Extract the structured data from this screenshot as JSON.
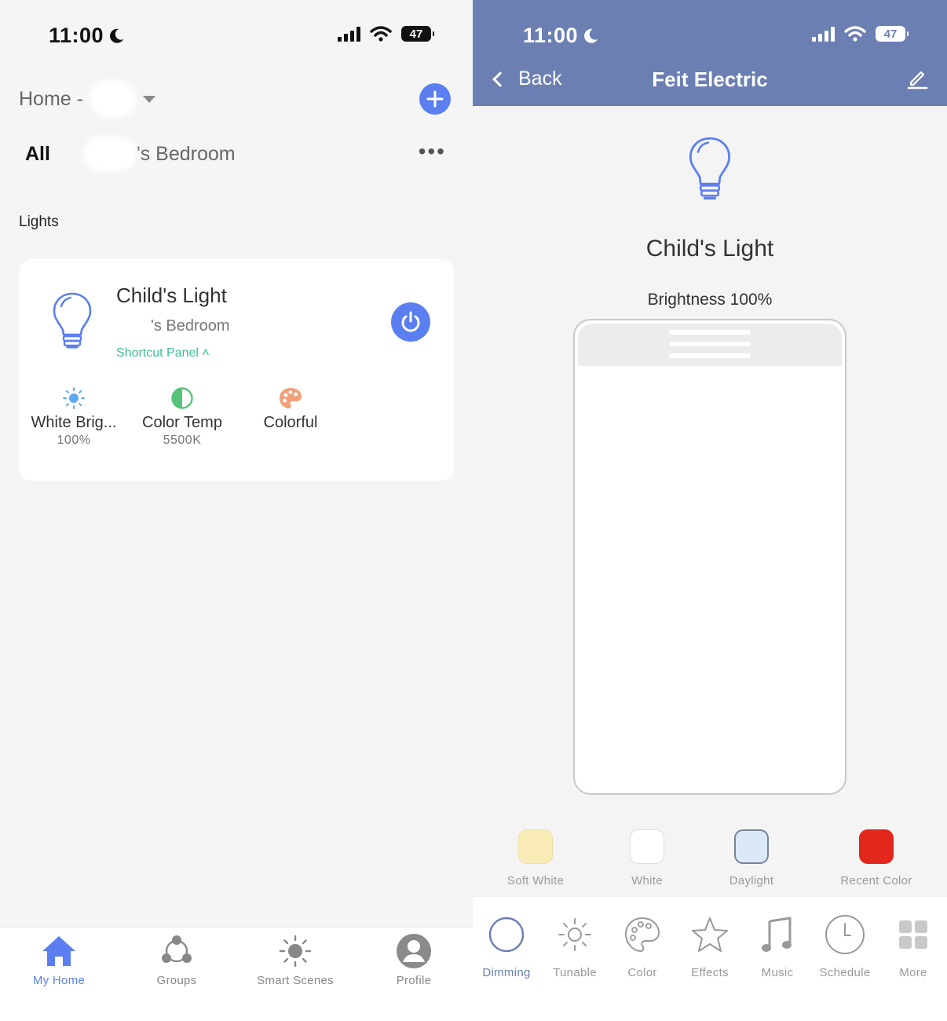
{
  "left_screen": {
    "status": {
      "time": "11:00",
      "battery": "47"
    },
    "home": {
      "title": "Home -"
    },
    "rooms": {
      "all": "All",
      "selected": "'s Bedroom"
    },
    "section": {
      "lights_label": "Lights"
    },
    "device_card": {
      "name": "Child's Light",
      "room": "'s Bedroom",
      "shortcut": "Shortcut Panel ˄",
      "power_on": true,
      "quick_controls": [
        {
          "label": "White Brig...",
          "value": "100%",
          "icon": "sun-icon"
        },
        {
          "label": "Color Temp",
          "value": "5500K",
          "icon": "half-circle-icon"
        },
        {
          "label": "Colorful",
          "value": "",
          "icon": "palette-icon"
        }
      ]
    },
    "tabbar": [
      {
        "label": "My Home",
        "icon": "house-icon",
        "active": true
      },
      {
        "label": "Groups",
        "icon": "groups-icon",
        "active": false
      },
      {
        "label": "Smart Scenes",
        "icon": "sun-icon",
        "active": false
      },
      {
        "label": "Profile",
        "icon": "person-icon",
        "active": false
      }
    ]
  },
  "right_screen": {
    "status": {
      "time": "11:00",
      "battery": "47"
    },
    "nav": {
      "back_label": "Back",
      "title": "Feit Electric"
    },
    "device": {
      "name": "Child's Light",
      "brightness_text": "Brightness 100%",
      "brightness": 100
    },
    "presets": [
      {
        "label": "Soft White",
        "color": "#f9ebb6"
      },
      {
        "label": "White",
        "color": "#ffffff"
      },
      {
        "label": "Daylight",
        "color": "#dbe8f8"
      },
      {
        "label": "Recent Color",
        "color": "#e2281d"
      }
    ],
    "tabbar": [
      {
        "label": "Dimming",
        "icon": "moon-icon",
        "active": true
      },
      {
        "label": "Tunable",
        "icon": "sun-icon",
        "active": false
      },
      {
        "label": "Color",
        "icon": "palette-icon",
        "active": false
      },
      {
        "label": "Effects",
        "icon": "star-icon",
        "active": false
      },
      {
        "label": "Music",
        "icon": "music-note-icon",
        "active": false
      },
      {
        "label": "Schedule",
        "icon": "clock-icon",
        "active": false
      },
      {
        "label": "More",
        "icon": "grid-icon",
        "active": false
      }
    ]
  },
  "colors": {
    "accent_blue": "#5b7ff0",
    "header_blue": "#6b7fb2",
    "shortcut_green": "#3dbf9a"
  }
}
